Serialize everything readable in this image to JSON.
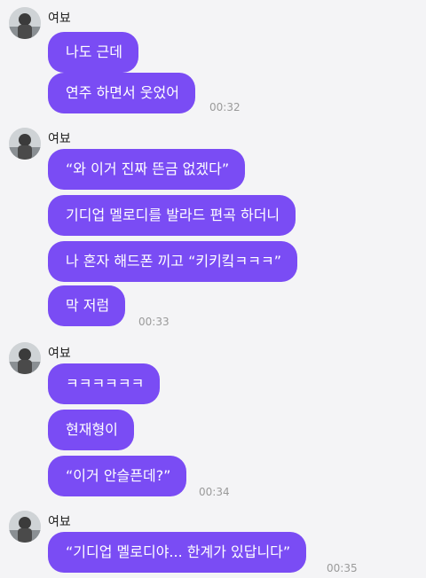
{
  "colors": {
    "bubble": "#7a4cf4",
    "background": "#f4f4f6",
    "timestamp": "#9a9a9a"
  },
  "icons": {
    "avatar": "profile-photo-icon"
  },
  "groups": [
    {
      "sender": "여뵤",
      "messages": [
        "나도 근데",
        "연주 하면서 웃었어"
      ],
      "time": "00:32"
    },
    {
      "sender": "여뵤",
      "messages": [
        "“와 이거 진짜 뜬금 없겠다”",
        "기디업 멜로디를 발라드 편곡 하더니",
        "나 혼자 해드폰 끼고 “키키킼ㅋㅋㅋ”",
        "막 저럼"
      ],
      "time": "00:33"
    },
    {
      "sender": "여뵤",
      "messages": [
        "ㅋㅋㅋㅋㅋㅋ",
        "현재형이",
        "“이거 안슬픈데?”"
      ],
      "time": "00:34"
    },
    {
      "sender": "여뵤",
      "messages": [
        "“기디업 멜로디야... 한계가 있답니다”"
      ],
      "time": "00:35"
    }
  ]
}
